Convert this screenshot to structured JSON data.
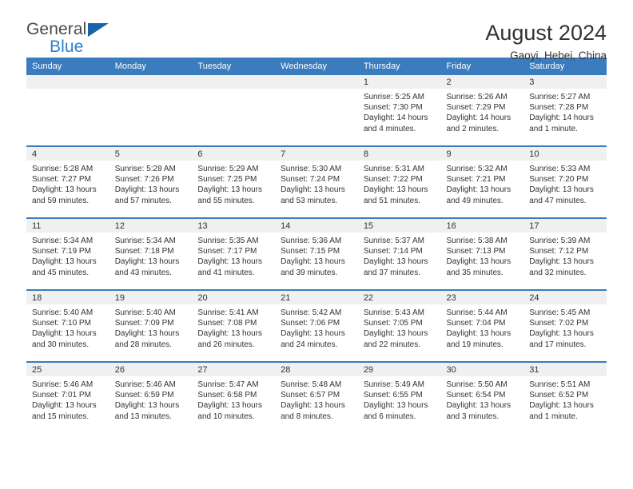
{
  "brand": {
    "name_part1": "General",
    "name_part2": "Blue",
    "triangle_color": "#1565a8",
    "blue_color": "#2a7fc9"
  },
  "header": {
    "title": "August 2024",
    "subtitle": "Gaoyi, Hebei, China"
  },
  "theme": {
    "header_blue": "#3a7cbe",
    "daynum_band": "#f0f0f0"
  },
  "weekdays": [
    "Sunday",
    "Monday",
    "Tuesday",
    "Wednesday",
    "Thursday",
    "Friday",
    "Saturday"
  ],
  "labels": {
    "sunrise_prefix": "Sunrise: ",
    "sunset_prefix": "Sunset: ",
    "daylight_prefix": "Daylight: "
  },
  "weeks": [
    [
      {
        "empty": true
      },
      {
        "empty": true
      },
      {
        "empty": true
      },
      {
        "empty": true
      },
      {
        "day": "1",
        "sunrise": "Sunrise: 5:25 AM",
        "sunset": "Sunset: 7:30 PM",
        "daylight": "Daylight: 14 hours and 4 minutes."
      },
      {
        "day": "2",
        "sunrise": "Sunrise: 5:26 AM",
        "sunset": "Sunset: 7:29 PM",
        "daylight": "Daylight: 14 hours and 2 minutes."
      },
      {
        "day": "3",
        "sunrise": "Sunrise: 5:27 AM",
        "sunset": "Sunset: 7:28 PM",
        "daylight": "Daylight: 14 hours and 1 minute."
      }
    ],
    [
      {
        "day": "4",
        "sunrise": "Sunrise: 5:28 AM",
        "sunset": "Sunset: 7:27 PM",
        "daylight": "Daylight: 13 hours and 59 minutes."
      },
      {
        "day": "5",
        "sunrise": "Sunrise: 5:28 AM",
        "sunset": "Sunset: 7:26 PM",
        "daylight": "Daylight: 13 hours and 57 minutes."
      },
      {
        "day": "6",
        "sunrise": "Sunrise: 5:29 AM",
        "sunset": "Sunset: 7:25 PM",
        "daylight": "Daylight: 13 hours and 55 minutes."
      },
      {
        "day": "7",
        "sunrise": "Sunrise: 5:30 AM",
        "sunset": "Sunset: 7:24 PM",
        "daylight": "Daylight: 13 hours and 53 minutes."
      },
      {
        "day": "8",
        "sunrise": "Sunrise: 5:31 AM",
        "sunset": "Sunset: 7:22 PM",
        "daylight": "Daylight: 13 hours and 51 minutes."
      },
      {
        "day": "9",
        "sunrise": "Sunrise: 5:32 AM",
        "sunset": "Sunset: 7:21 PM",
        "daylight": "Daylight: 13 hours and 49 minutes."
      },
      {
        "day": "10",
        "sunrise": "Sunrise: 5:33 AM",
        "sunset": "Sunset: 7:20 PM",
        "daylight": "Daylight: 13 hours and 47 minutes."
      }
    ],
    [
      {
        "day": "11",
        "sunrise": "Sunrise: 5:34 AM",
        "sunset": "Sunset: 7:19 PM",
        "daylight": "Daylight: 13 hours and 45 minutes."
      },
      {
        "day": "12",
        "sunrise": "Sunrise: 5:34 AM",
        "sunset": "Sunset: 7:18 PM",
        "daylight": "Daylight: 13 hours and 43 minutes."
      },
      {
        "day": "13",
        "sunrise": "Sunrise: 5:35 AM",
        "sunset": "Sunset: 7:17 PM",
        "daylight": "Daylight: 13 hours and 41 minutes."
      },
      {
        "day": "14",
        "sunrise": "Sunrise: 5:36 AM",
        "sunset": "Sunset: 7:15 PM",
        "daylight": "Daylight: 13 hours and 39 minutes."
      },
      {
        "day": "15",
        "sunrise": "Sunrise: 5:37 AM",
        "sunset": "Sunset: 7:14 PM",
        "daylight": "Daylight: 13 hours and 37 minutes."
      },
      {
        "day": "16",
        "sunrise": "Sunrise: 5:38 AM",
        "sunset": "Sunset: 7:13 PM",
        "daylight": "Daylight: 13 hours and 35 minutes."
      },
      {
        "day": "17",
        "sunrise": "Sunrise: 5:39 AM",
        "sunset": "Sunset: 7:12 PM",
        "daylight": "Daylight: 13 hours and 32 minutes."
      }
    ],
    [
      {
        "day": "18",
        "sunrise": "Sunrise: 5:40 AM",
        "sunset": "Sunset: 7:10 PM",
        "daylight": "Daylight: 13 hours and 30 minutes."
      },
      {
        "day": "19",
        "sunrise": "Sunrise: 5:40 AM",
        "sunset": "Sunset: 7:09 PM",
        "daylight": "Daylight: 13 hours and 28 minutes."
      },
      {
        "day": "20",
        "sunrise": "Sunrise: 5:41 AM",
        "sunset": "Sunset: 7:08 PM",
        "daylight": "Daylight: 13 hours and 26 minutes."
      },
      {
        "day": "21",
        "sunrise": "Sunrise: 5:42 AM",
        "sunset": "Sunset: 7:06 PM",
        "daylight": "Daylight: 13 hours and 24 minutes."
      },
      {
        "day": "22",
        "sunrise": "Sunrise: 5:43 AM",
        "sunset": "Sunset: 7:05 PM",
        "daylight": "Daylight: 13 hours and 22 minutes."
      },
      {
        "day": "23",
        "sunrise": "Sunrise: 5:44 AM",
        "sunset": "Sunset: 7:04 PM",
        "daylight": "Daylight: 13 hours and 19 minutes."
      },
      {
        "day": "24",
        "sunrise": "Sunrise: 5:45 AM",
        "sunset": "Sunset: 7:02 PM",
        "daylight": "Daylight: 13 hours and 17 minutes."
      }
    ],
    [
      {
        "day": "25",
        "sunrise": "Sunrise: 5:46 AM",
        "sunset": "Sunset: 7:01 PM",
        "daylight": "Daylight: 13 hours and 15 minutes."
      },
      {
        "day": "26",
        "sunrise": "Sunrise: 5:46 AM",
        "sunset": "Sunset: 6:59 PM",
        "daylight": "Daylight: 13 hours and 13 minutes."
      },
      {
        "day": "27",
        "sunrise": "Sunrise: 5:47 AM",
        "sunset": "Sunset: 6:58 PM",
        "daylight": "Daylight: 13 hours and 10 minutes."
      },
      {
        "day": "28",
        "sunrise": "Sunrise: 5:48 AM",
        "sunset": "Sunset: 6:57 PM",
        "daylight": "Daylight: 13 hours and 8 minutes."
      },
      {
        "day": "29",
        "sunrise": "Sunrise: 5:49 AM",
        "sunset": "Sunset: 6:55 PM",
        "daylight": "Daylight: 13 hours and 6 minutes."
      },
      {
        "day": "30",
        "sunrise": "Sunrise: 5:50 AM",
        "sunset": "Sunset: 6:54 PM",
        "daylight": "Daylight: 13 hours and 3 minutes."
      },
      {
        "day": "31",
        "sunrise": "Sunrise: 5:51 AM",
        "sunset": "Sunset: 6:52 PM",
        "daylight": "Daylight: 13 hours and 1 minute."
      }
    ]
  ]
}
